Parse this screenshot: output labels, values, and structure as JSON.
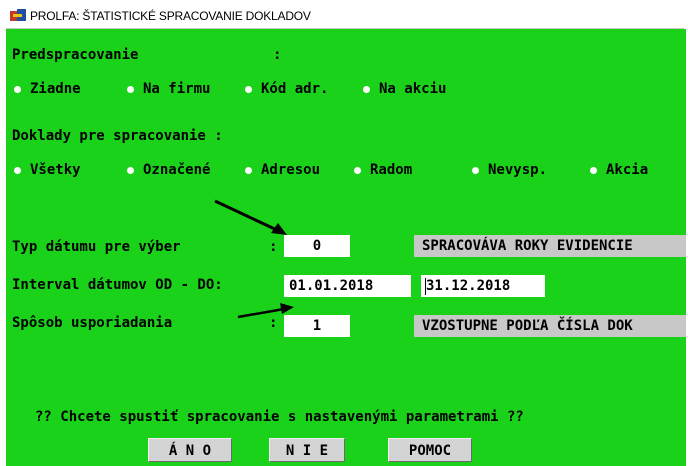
{
  "window": {
    "title": "PROLFA: ŠTATISTICKÉ SPRACOVANIE DOKLADOV",
    "app_icon": "prolfa-app-icon"
  },
  "preprocess": {
    "label": "Predspracovanie",
    "colon": ":",
    "options": [
      "Ziadne",
      "Na firmu",
      "Kód adr.",
      "Na akciu"
    ],
    "selected": "Ziadne"
  },
  "documents": {
    "label": "Doklady pre spracovanie :",
    "options": [
      "Všetky",
      "Označené",
      "Adresou",
      "Radom",
      "Nevysp.",
      "Akcia"
    ],
    "selected": "Všetky"
  },
  "date_type": {
    "label": "Typ dátumu pre výber",
    "colon": ":",
    "value": "0",
    "description": "SPRACOVÁVA ROKY EVIDENCIE"
  },
  "date_interval": {
    "label": "Interval dátumov OD - DO:",
    "from": "01.01.2018",
    "to": "31.12.2018"
  },
  "sort": {
    "label": "Spôsob usporiadania",
    "colon": ":",
    "value": "1",
    "description": "VZOSTUPNE PODĽA ČÍSLA DOK"
  },
  "prompt": "?? Chcete spustiť spracovanie s nastavenými parametrami ??",
  "buttons": {
    "yes": "Á N O",
    "no": "N I E",
    "help": "POMOC"
  },
  "colors": {
    "background": "#1ad21a",
    "field": "#ffffff",
    "label_box": "#c8c8c8",
    "button": "#d4d4d4"
  }
}
